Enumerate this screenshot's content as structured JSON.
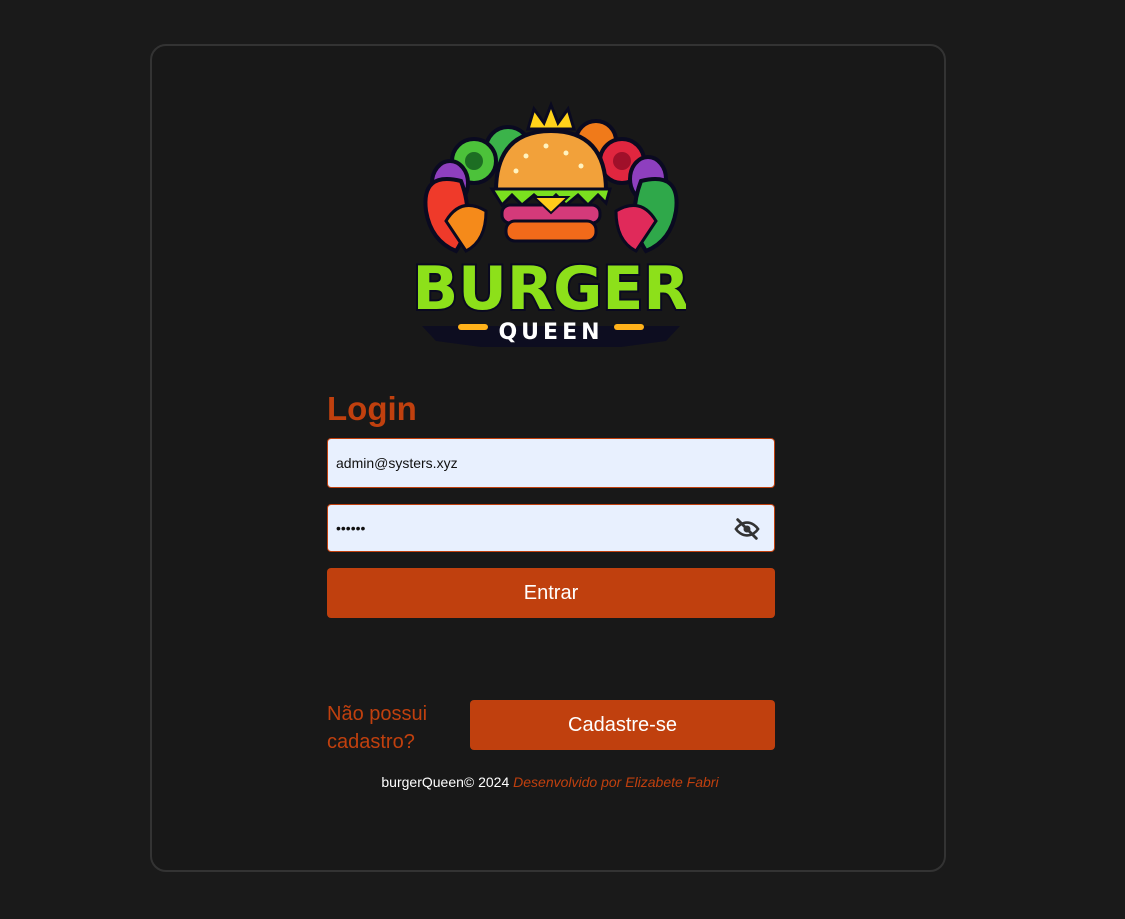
{
  "logo": {
    "text_main": "BURGER",
    "text_sub": "QUEEN"
  },
  "login": {
    "title": "Login",
    "email_value": "admin@systers.xyz",
    "password_value": "••••••",
    "toggle_icon": "eye-off-icon",
    "submit_label": "Entrar"
  },
  "signup": {
    "prompt": "Não possui\ncadastro?",
    "button_label": "Cadastre-se"
  },
  "footer": {
    "copyright": "burgerQueen© 2024",
    "developer": "Desenvolvido por Elizabete Fabri"
  },
  "colors": {
    "background": "#1a1a1a",
    "accent": "#c0400e",
    "field_bg": "#e8f0fe"
  }
}
